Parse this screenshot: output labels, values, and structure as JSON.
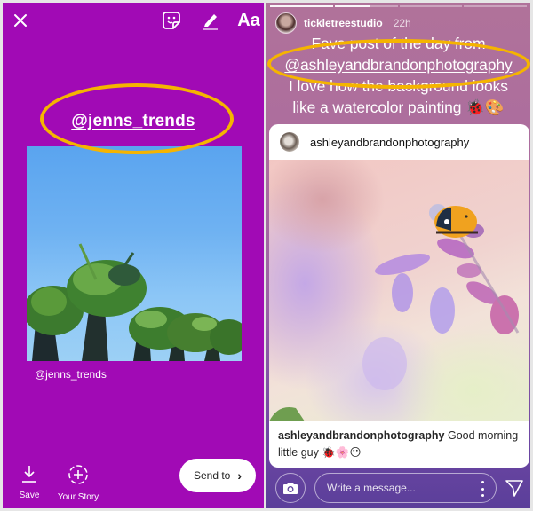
{
  "left_panel": {
    "toolbar": {
      "close_icon": "close-icon",
      "sticker_icon": "sticker-icon",
      "draw_icon": "pen-icon",
      "text_tool_label": "Aa"
    },
    "mention_sticker": "@jenns_trends",
    "photo_caption": "@jenns_trends",
    "actions": {
      "save_label": "Save",
      "your_story_label": "Your Story",
      "send_to_label": "Send to",
      "send_to_chevron": "›"
    },
    "colors": {
      "background": "#a10ab5",
      "highlight": "#f5b400"
    }
  },
  "right_panel": {
    "progress": [
      1.0,
      0.55,
      0.0,
      0.0
    ],
    "story_header": {
      "username": "tickletreestudio",
      "time": "22h"
    },
    "story_text": {
      "line1": "Fave post of the day from",
      "mention": "@ashleyandbrandonphotography",
      "line3": "I love how the background looks",
      "line4": "like a watercolor painting 🐞🎨"
    },
    "post": {
      "username": "ashleyandbrandonphotography",
      "caption_user": "ashleyandbrandonphotography",
      "caption_text": " Good morning little guy 🐞🌸😶"
    },
    "reply_bar": {
      "message_placeholder": "Write a message..."
    },
    "colors": {
      "highlight": "#f5b400",
      "gradient_top": "#b0729a",
      "gradient_bottom": "#5b3f9a"
    }
  }
}
